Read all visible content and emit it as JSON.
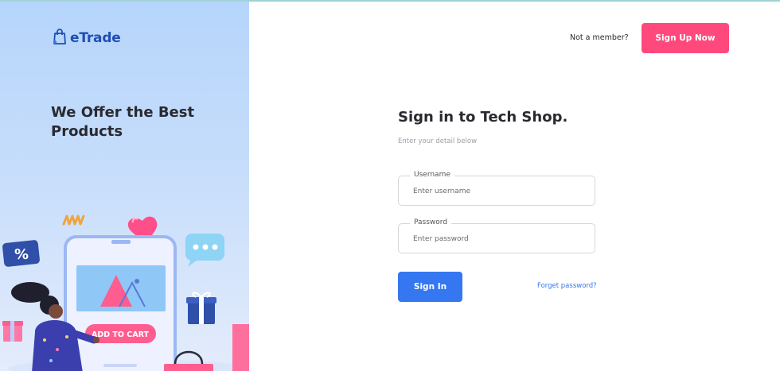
{
  "brand": {
    "name": "eTrade",
    "icon": "shopping-bag-icon",
    "color": "#1e4fb4"
  },
  "promo": {
    "headline": "We Offer the Best Products",
    "illustration": {
      "add_to_cart_label": "ADD TO CART",
      "percent_label": "%",
      "icons": [
        "heart-icon",
        "percent-tag-icon",
        "chat-bubble-icon",
        "gift-box-icon",
        "shopping-bag-icon",
        "smartphone-icon"
      ]
    }
  },
  "header": {
    "member_prompt": "Not a member?",
    "signup_label": "Sign Up Now"
  },
  "form": {
    "title": "Sign in to Tech Shop.",
    "subtitle": "Enter your detail below",
    "username": {
      "label": "Username",
      "placeholder": "Enter username",
      "value": ""
    },
    "password": {
      "label": "Password",
      "placeholder": "Enter password",
      "value": ""
    },
    "signin_label": "Sign In",
    "forgot_label": "Forget password?"
  },
  "colors": {
    "accent_pink": "#ff497c",
    "accent_blue": "#3577f0",
    "promo_bg": "#c6ddfb",
    "text_dark": "#292930"
  }
}
